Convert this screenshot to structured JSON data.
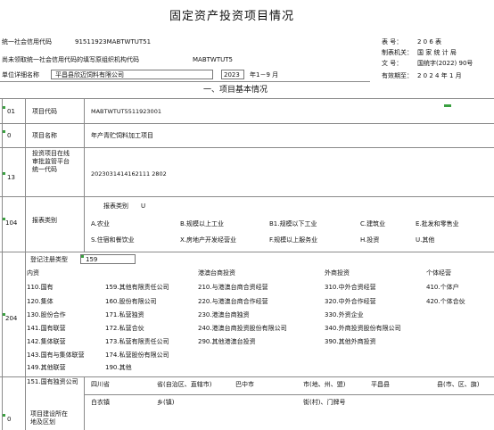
{
  "title": "固定资产投资项目情况",
  "header": {
    "credit_label": "统一社会信用代码",
    "credit_value": "91511923MABTWTUT51",
    "unclaimed_label": "尚未领取统一社会信用代码的填写原组织机构代码",
    "unclaimed_value": "MABTWTUT5",
    "unit_label": "单位详细名称",
    "unit_value": "平昌县欣迈饲料有限公司",
    "period_year": "2023",
    "period_text": "年1－9  月",
    "form_no_label": "表    号：",
    "form_no_value": "2  0  6  表",
    "org_label": "制表机关：",
    "org_value": "国 家 统 计 局",
    "doc_label": "文    号：",
    "doc_value": "国统字(2022) 90号",
    "valid_label": "有效期至：",
    "valid_value": "2 0 2 4  年  1  月"
  },
  "section_title": "一、项目基本情况",
  "rows": {
    "r1": {
      "code": "01",
      "label": "项目代码",
      "value": "MABTWTUT5511923001"
    },
    "r2": {
      "code": "0",
      "label": "项目名称",
      "value": "年产青贮饲料加工项目"
    },
    "r3": {
      "code": "13",
      "label": "投资项目在线审批监管平台统一代码",
      "value": "2023031414162111 2802"
    },
    "r4": {
      "code": "104",
      "label": "报表类别",
      "selected_label": "报表类别",
      "selected_value": "U"
    },
    "r5": {
      "code": "204"
    },
    "r6": {
      "code": "0",
      "label": "项目建设所在地及区划"
    }
  },
  "report_types": [
    "A.农业",
    "B.规模以上工业",
    "B1.规模以下工业",
    "C.建筑业",
    "E.批发和零售业",
    "S.住宿和餐饮业",
    "X.房地产开发经营业",
    "F.规模以上服务业",
    "H.投资",
    "U.其他"
  ],
  "registration": {
    "label": "登记注册类型",
    "value": "159",
    "headers": [
      "内资",
      "港澳台商投资",
      "外商投资",
      "个体经营"
    ],
    "col1": [
      "110.国有",
      "120.集体",
      "130.股份合作",
      "141.国有联营",
      "142.集体联营",
      "143.国有与集体联营",
      "149.其他联营",
      "151.国有独资公司"
    ],
    "col2": [
      "159.其他有限责任公司",
      "160.股份有限公司",
      "171.私营独资",
      "172.私营合伙",
      "173.私营有限责任公司",
      "174.私营股份有限公司",
      "190.其他"
    ],
    "col3": [
      "210.与港澳台商合资经营",
      "220.与港澳台商合作经营",
      "230.港澳台商独资",
      "240.港澳台商投资股份有限公司",
      "290.其他港澳台投资"
    ],
    "col4": [
      "310.中外合资经营",
      "320.中外合作经营",
      "330.外资企业",
      "340.外商投资股份有限公司",
      "390.其他外商投资"
    ],
    "col5": [
      "410.个体户",
      "420.个体合伙"
    ]
  },
  "location": {
    "row1": {
      "prov_value": "四川省",
      "prov_label": "省(自治区、直辖市)",
      "city_value": "巴中市",
      "city_label": "市(地、州、盟)",
      "county_value": "平昌县",
      "county_label": "县(市、区、旗)"
    },
    "row2": {
      "town_value": "白衣镇",
      "town_label": "乡(镇)",
      "street_label": "街(村)、门牌号"
    }
  }
}
